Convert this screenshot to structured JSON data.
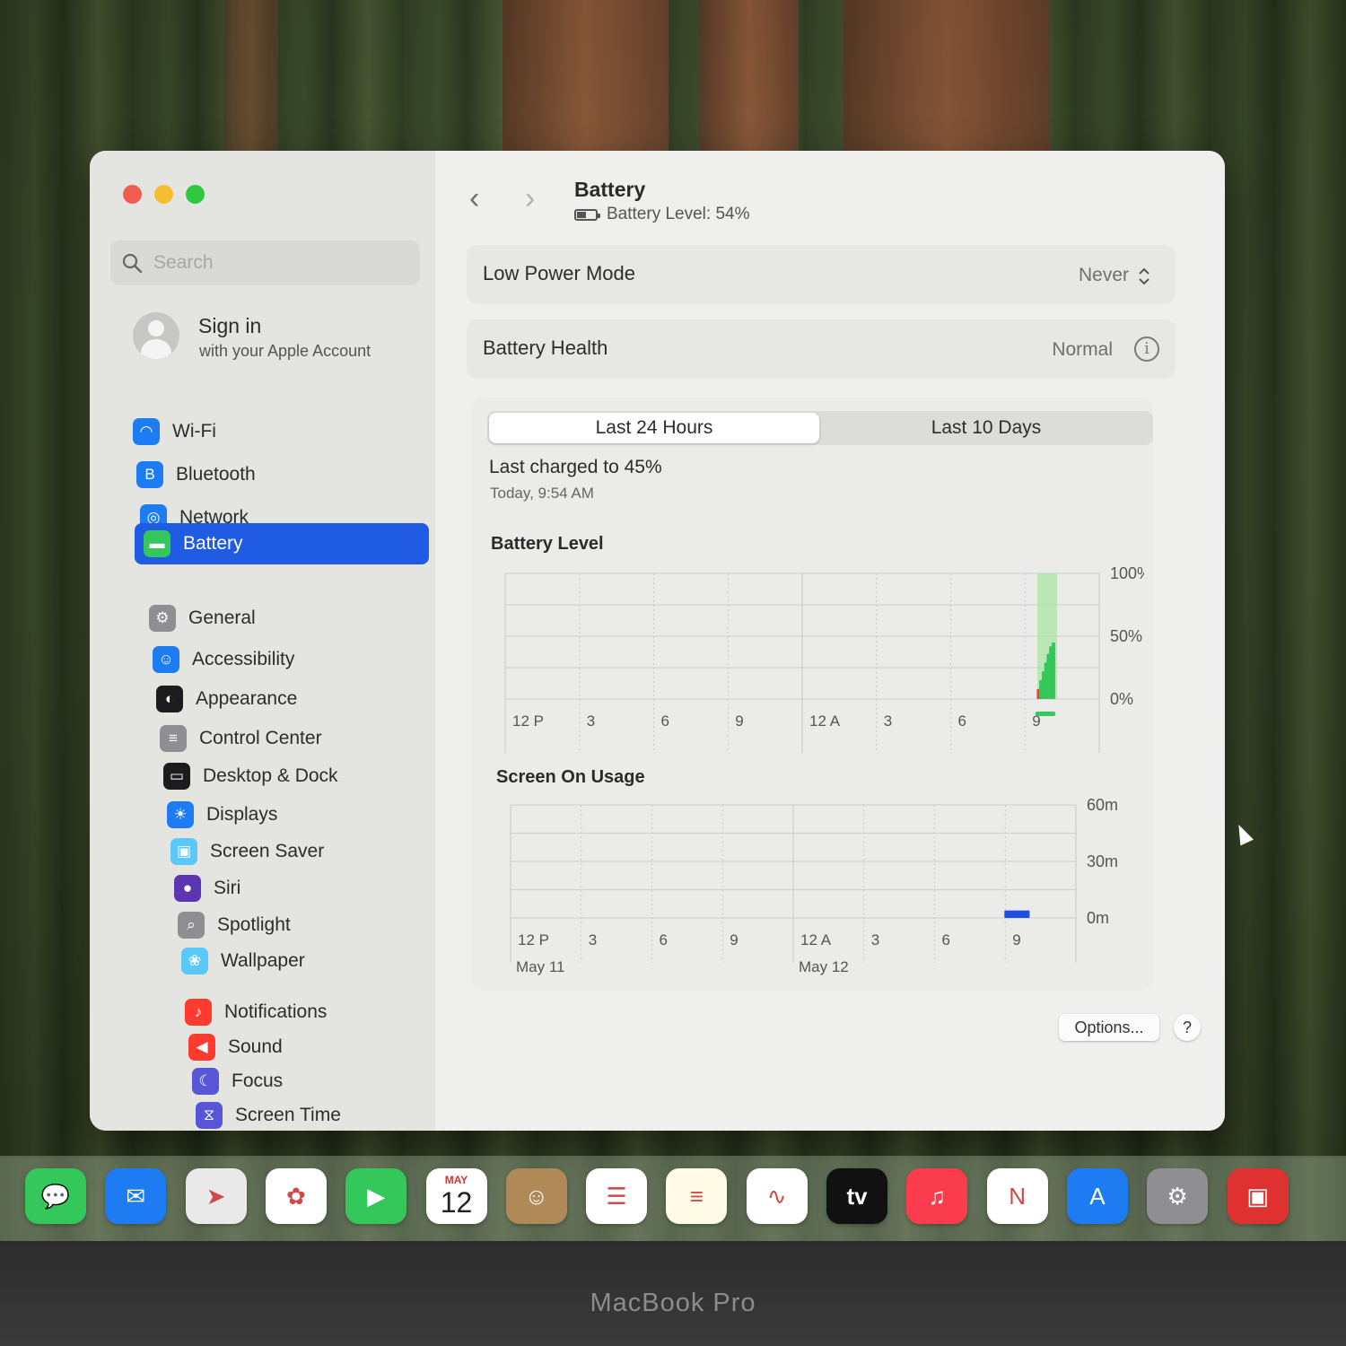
{
  "window": {
    "search_placeholder": "Search",
    "account": {
      "title": "Sign in",
      "subtitle": "with your Apple Account"
    }
  },
  "sidebar": {
    "items": [
      {
        "label": "Wi-Fi",
        "icon": "wifi-icon",
        "color": "#1e7cf2"
      },
      {
        "label": "Bluetooth",
        "icon": "bluetooth-icon",
        "color": "#1e7cf2"
      },
      {
        "label": "Network",
        "icon": "globe-icon",
        "color": "#1e7cf2"
      },
      {
        "label": "Battery",
        "icon": "battery-icon",
        "color": "#34c759"
      },
      {
        "label": "General",
        "icon": "gear-icon",
        "color": "#8e8e93"
      },
      {
        "label": "Accessibility",
        "icon": "accessibility-icon",
        "color": "#1e7cf2"
      },
      {
        "label": "Appearance",
        "icon": "appearance-icon",
        "color": "#1c1c1e"
      },
      {
        "label": "Control Center",
        "icon": "control-center-icon",
        "color": "#8e8e93"
      },
      {
        "label": "Desktop & Dock",
        "icon": "desktop-dock-icon",
        "color": "#1c1c1e"
      },
      {
        "label": "Displays",
        "icon": "sun-icon",
        "color": "#1e7cf2"
      },
      {
        "label": "Screen Saver",
        "icon": "screen-saver-icon",
        "color": "#5ac8fa"
      },
      {
        "label": "Siri",
        "icon": "siri-icon",
        "color": "#5e35b1"
      },
      {
        "label": "Spotlight",
        "icon": "magnifier-icon",
        "color": "#8e8e93"
      },
      {
        "label": "Wallpaper",
        "icon": "flower-icon",
        "color": "#5ac8fa"
      },
      {
        "label": "Notifications",
        "icon": "bell-icon",
        "color": "#ff3b30"
      },
      {
        "label": "Sound",
        "icon": "speaker-icon",
        "color": "#ff3b30"
      },
      {
        "label": "Focus",
        "icon": "moon-icon",
        "color": "#5856d6"
      },
      {
        "label": "Screen Time",
        "icon": "hourglass-icon",
        "color": "#5856d6"
      }
    ],
    "active": "Battery"
  },
  "header": {
    "title": "Battery",
    "subtitle": "Battery Level: 54%"
  },
  "settings": {
    "low_power_label": "Low Power Mode",
    "low_power_value": "Never",
    "health_label": "Battery Health",
    "health_value": "Normal"
  },
  "tabs": {
    "left": "Last 24 Hours",
    "right": "Last 10 Days",
    "selected": "Last 24 Hours"
  },
  "charge": {
    "text": "Last charged to 45%",
    "time": "Today, 9:54 AM"
  },
  "chart_data": [
    {
      "type": "bar",
      "title": "Battery Level",
      "x_ticks": [
        "12 P",
        "3",
        "6",
        "9",
        "12 A",
        "3",
        "6",
        "9"
      ],
      "y_ticks": [
        "100%",
        "50%",
        "0%"
      ],
      "ylim": [
        0,
        100
      ],
      "charging_window": {
        "start_hour": 21.5,
        "end_hour": 22.3
      },
      "bars": [
        {
          "hour": 21.55,
          "value": 8,
          "color": "#ff3b30"
        },
        {
          "hour": 21.65,
          "value": 15,
          "color": "#34c759"
        },
        {
          "hour": 21.75,
          "value": 22,
          "color": "#34c759"
        },
        {
          "hour": 21.85,
          "value": 29,
          "color": "#34c759"
        },
        {
          "hour": 21.95,
          "value": 36,
          "color": "#34c759"
        },
        {
          "hour": 22.05,
          "value": 42,
          "color": "#34c759"
        },
        {
          "hour": 22.15,
          "value": 45,
          "color": "#34c759"
        }
      ],
      "grid": true
    },
    {
      "type": "bar",
      "title": "Screen On Usage",
      "x_ticks": [
        "12 P",
        "3",
        "6",
        "9",
        "12 A",
        "3",
        "6",
        "9"
      ],
      "date_labels": [
        "May 11",
        "May 12"
      ],
      "y_ticks": [
        "60m",
        "30m",
        "0m"
      ],
      "ylim": [
        0,
        60
      ],
      "bars": [
        {
          "hour": 21.25,
          "value": 4,
          "color": "#1e4fe0"
        },
        {
          "hour": 21.75,
          "value": 4,
          "color": "#1e4fe0"
        }
      ],
      "grid": true
    }
  ],
  "footer": {
    "options": "Options...",
    "help": "?"
  },
  "dock": {
    "apps": [
      {
        "name": "Messages",
        "icon": "messages-icon",
        "color": "#34c759"
      },
      {
        "name": "Mail",
        "icon": "mail-icon",
        "color": "#1e7cf2"
      },
      {
        "name": "Maps",
        "icon": "maps-icon",
        "color": "#e9e9e9"
      },
      {
        "name": "Photos",
        "icon": "photos-icon",
        "color": "#ffffff"
      },
      {
        "name": "FaceTime",
        "icon": "facetime-icon",
        "color": "#34c759"
      },
      {
        "name": "Calendar",
        "icon": "calendar-icon",
        "color": "#ffffff"
      },
      {
        "name": "Contacts",
        "icon": "contacts-icon",
        "color": "#b08a56"
      },
      {
        "name": "Reminders",
        "icon": "reminders-icon",
        "color": "#ffffff"
      },
      {
        "name": "Notes",
        "icon": "notes-icon",
        "color": "#fffbe6"
      },
      {
        "name": "Freeform",
        "icon": "freeform-icon",
        "color": "#ffffff"
      },
      {
        "name": "TV",
        "icon": "tv-icon",
        "color": "#111111"
      },
      {
        "name": "Music",
        "icon": "music-icon",
        "color": "#fa3c4c"
      },
      {
        "name": "News",
        "icon": "news-icon",
        "color": "#ffffff"
      },
      {
        "name": "App Store",
        "icon": "app-store-icon",
        "color": "#1e7cf2"
      },
      {
        "name": "System Settings",
        "icon": "settings-icon",
        "color": "#8e8e93"
      },
      {
        "name": "Photo Booth",
        "icon": "photo-booth-icon",
        "color": "#e03131"
      }
    ],
    "calendar_month": "MAY",
    "calendar_day": "12",
    "tv_label": "tv"
  },
  "device": {
    "brand": "MacBook Pro"
  }
}
